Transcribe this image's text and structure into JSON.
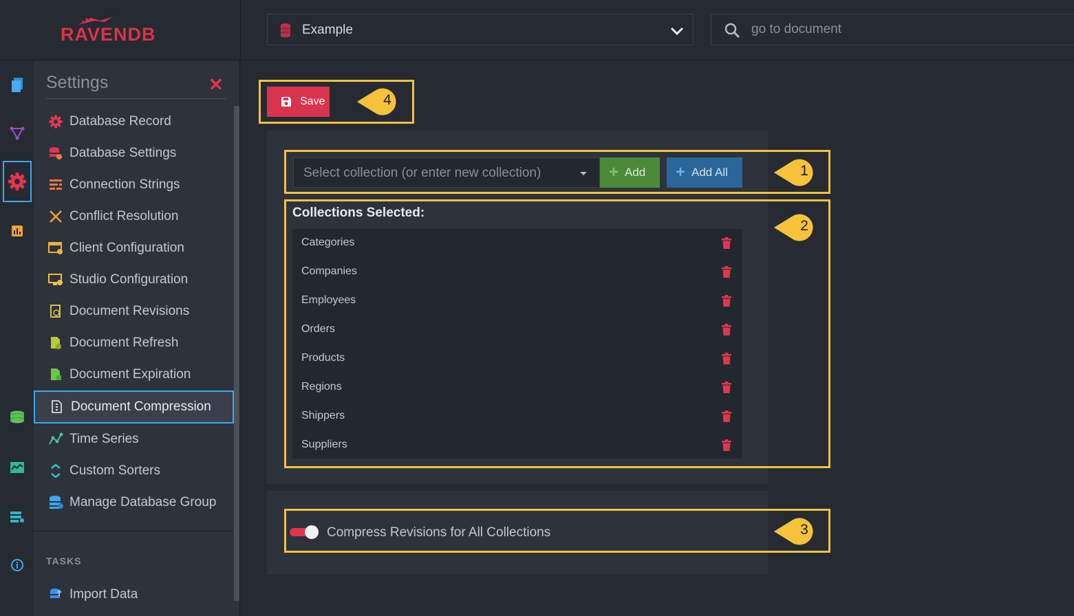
{
  "brand": {
    "logo_text": "RAVENDB"
  },
  "header": {
    "database": "Example",
    "search_placeholder": "go to document"
  },
  "rail": {
    "icons": [
      "documents-icon",
      "indexes-icon",
      "settings-icon",
      "stats-icon",
      "databases-icon",
      "dashboard-icon",
      "cluster-icon",
      "about-icon"
    ]
  },
  "menu": {
    "title": "Settings",
    "items": [
      {
        "label": "Database Record",
        "icon": "gear-icon"
      },
      {
        "label": "Database Settings",
        "icon": "database-settings-icon"
      },
      {
        "label": "Connection Strings",
        "icon": "connection-strings-icon"
      },
      {
        "label": "Conflict Resolution",
        "icon": "conflict-icon"
      },
      {
        "label": "Client Configuration",
        "icon": "client-config-icon"
      },
      {
        "label": "Studio Configuration",
        "icon": "studio-config-icon"
      },
      {
        "label": "Document Revisions",
        "icon": "revisions-icon"
      },
      {
        "label": "Document Refresh",
        "icon": "refresh-icon"
      },
      {
        "label": "Document Expiration",
        "icon": "expiration-icon"
      },
      {
        "label": "Document Compression",
        "icon": "compression-icon",
        "active": true
      },
      {
        "label": "Time Series",
        "icon": "timeseries-icon"
      },
      {
        "label": "Custom Sorters",
        "icon": "sorters-icon"
      },
      {
        "label": "Manage Database Group",
        "icon": "database-group-icon"
      }
    ],
    "tasks_label": "TASKS",
    "task_items": [
      {
        "label": "Import Data",
        "icon": "import-icon"
      }
    ]
  },
  "toolbar": {
    "save_label": "Save"
  },
  "collections": {
    "select_placeholder": "Select collection (or enter new collection)",
    "add_label": "Add",
    "add_all_label": "Add All",
    "heading": "Collections Selected:",
    "items": [
      "Categories",
      "Companies",
      "Employees",
      "Orders",
      "Products",
      "Regions",
      "Shippers",
      "Suppliers"
    ]
  },
  "compression": {
    "toggle_label": "Compress Revisions for All Collections",
    "toggle_on": true
  },
  "callouts": [
    "1",
    "2",
    "3",
    "4"
  ],
  "colors": {
    "accent_red": "#d9334d",
    "add_green": "#4c8a3a",
    "add_all_blue": "#2a6699",
    "highlight_yellow": "#f5c23a",
    "active_blue": "#3da9ee"
  }
}
